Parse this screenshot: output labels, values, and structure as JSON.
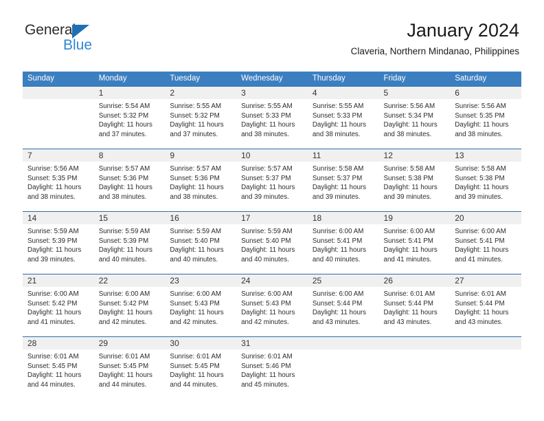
{
  "brand": {
    "name_top": "General",
    "name_bottom": "Blue",
    "accent_color": "#2f86d4",
    "triangle_color": "#1f6fb5"
  },
  "header": {
    "title": "January 2024",
    "subtitle": "Claveria, Northern Mindanao, Philippines"
  },
  "theme": {
    "header_row_bg": "#3c7fc1",
    "daynum_bg": "#f0f0f0",
    "row_border": "#2e6ca8",
    "text": "#2b2b2b"
  },
  "weekday_headers": [
    "Sunday",
    "Monday",
    "Tuesday",
    "Wednesday",
    "Thursday",
    "Friday",
    "Saturday"
  ],
  "labels": {
    "sunrise_prefix": "Sunrise:",
    "sunset_prefix": "Sunset:",
    "daylight_prefix": "Daylight:"
  },
  "weeks": [
    [
      {
        "day": "",
        "empty": true,
        "line1": "",
        "line2": "",
        "line3": "",
        "line4": ""
      },
      {
        "day": "1",
        "line1": "Sunrise: 5:54 AM",
        "line2": "Sunset: 5:32 PM",
        "line3": "Daylight: 11 hours",
        "line4": "and 37 minutes."
      },
      {
        "day": "2",
        "line1": "Sunrise: 5:55 AM",
        "line2": "Sunset: 5:32 PM",
        "line3": "Daylight: 11 hours",
        "line4": "and 37 minutes."
      },
      {
        "day": "3",
        "line1": "Sunrise: 5:55 AM",
        "line2": "Sunset: 5:33 PM",
        "line3": "Daylight: 11 hours",
        "line4": "and 38 minutes."
      },
      {
        "day": "4",
        "line1": "Sunrise: 5:55 AM",
        "line2": "Sunset: 5:33 PM",
        "line3": "Daylight: 11 hours",
        "line4": "and 38 minutes."
      },
      {
        "day": "5",
        "line1": "Sunrise: 5:56 AM",
        "line2": "Sunset: 5:34 PM",
        "line3": "Daylight: 11 hours",
        "line4": "and 38 minutes."
      },
      {
        "day": "6",
        "line1": "Sunrise: 5:56 AM",
        "line2": "Sunset: 5:35 PM",
        "line3": "Daylight: 11 hours",
        "line4": "and 38 minutes."
      }
    ],
    [
      {
        "day": "7",
        "line1": "Sunrise: 5:56 AM",
        "line2": "Sunset: 5:35 PM",
        "line3": "Daylight: 11 hours",
        "line4": "and 38 minutes."
      },
      {
        "day": "8",
        "line1": "Sunrise: 5:57 AM",
        "line2": "Sunset: 5:36 PM",
        "line3": "Daylight: 11 hours",
        "line4": "and 38 minutes."
      },
      {
        "day": "9",
        "line1": "Sunrise: 5:57 AM",
        "line2": "Sunset: 5:36 PM",
        "line3": "Daylight: 11 hours",
        "line4": "and 38 minutes."
      },
      {
        "day": "10",
        "line1": "Sunrise: 5:57 AM",
        "line2": "Sunset: 5:37 PM",
        "line3": "Daylight: 11 hours",
        "line4": "and 39 minutes."
      },
      {
        "day": "11",
        "line1": "Sunrise: 5:58 AM",
        "line2": "Sunset: 5:37 PM",
        "line3": "Daylight: 11 hours",
        "line4": "and 39 minutes."
      },
      {
        "day": "12",
        "line1": "Sunrise: 5:58 AM",
        "line2": "Sunset: 5:38 PM",
        "line3": "Daylight: 11 hours",
        "line4": "and 39 minutes."
      },
      {
        "day": "13",
        "line1": "Sunrise: 5:58 AM",
        "line2": "Sunset: 5:38 PM",
        "line3": "Daylight: 11 hours",
        "line4": "and 39 minutes."
      }
    ],
    [
      {
        "day": "14",
        "line1": "Sunrise: 5:59 AM",
        "line2": "Sunset: 5:39 PM",
        "line3": "Daylight: 11 hours",
        "line4": "and 39 minutes."
      },
      {
        "day": "15",
        "line1": "Sunrise: 5:59 AM",
        "line2": "Sunset: 5:39 PM",
        "line3": "Daylight: 11 hours",
        "line4": "and 40 minutes."
      },
      {
        "day": "16",
        "line1": "Sunrise: 5:59 AM",
        "line2": "Sunset: 5:40 PM",
        "line3": "Daylight: 11 hours",
        "line4": "and 40 minutes."
      },
      {
        "day": "17",
        "line1": "Sunrise: 5:59 AM",
        "line2": "Sunset: 5:40 PM",
        "line3": "Daylight: 11 hours",
        "line4": "and 40 minutes."
      },
      {
        "day": "18",
        "line1": "Sunrise: 6:00 AM",
        "line2": "Sunset: 5:41 PM",
        "line3": "Daylight: 11 hours",
        "line4": "and 40 minutes."
      },
      {
        "day": "19",
        "line1": "Sunrise: 6:00 AM",
        "line2": "Sunset: 5:41 PM",
        "line3": "Daylight: 11 hours",
        "line4": "and 41 minutes."
      },
      {
        "day": "20",
        "line1": "Sunrise: 6:00 AM",
        "line2": "Sunset: 5:41 PM",
        "line3": "Daylight: 11 hours",
        "line4": "and 41 minutes."
      }
    ],
    [
      {
        "day": "21",
        "line1": "Sunrise: 6:00 AM",
        "line2": "Sunset: 5:42 PM",
        "line3": "Daylight: 11 hours",
        "line4": "and 41 minutes."
      },
      {
        "day": "22",
        "line1": "Sunrise: 6:00 AM",
        "line2": "Sunset: 5:42 PM",
        "line3": "Daylight: 11 hours",
        "line4": "and 42 minutes."
      },
      {
        "day": "23",
        "line1": "Sunrise: 6:00 AM",
        "line2": "Sunset: 5:43 PM",
        "line3": "Daylight: 11 hours",
        "line4": "and 42 minutes."
      },
      {
        "day": "24",
        "line1": "Sunrise: 6:00 AM",
        "line2": "Sunset: 5:43 PM",
        "line3": "Daylight: 11 hours",
        "line4": "and 42 minutes."
      },
      {
        "day": "25",
        "line1": "Sunrise: 6:00 AM",
        "line2": "Sunset: 5:44 PM",
        "line3": "Daylight: 11 hours",
        "line4": "and 43 minutes."
      },
      {
        "day": "26",
        "line1": "Sunrise: 6:01 AM",
        "line2": "Sunset: 5:44 PM",
        "line3": "Daylight: 11 hours",
        "line4": "and 43 minutes."
      },
      {
        "day": "27",
        "line1": "Sunrise: 6:01 AM",
        "line2": "Sunset: 5:44 PM",
        "line3": "Daylight: 11 hours",
        "line4": "and 43 minutes."
      }
    ],
    [
      {
        "day": "28",
        "line1": "Sunrise: 6:01 AM",
        "line2": "Sunset: 5:45 PM",
        "line3": "Daylight: 11 hours",
        "line4": "and 44 minutes."
      },
      {
        "day": "29",
        "line1": "Sunrise: 6:01 AM",
        "line2": "Sunset: 5:45 PM",
        "line3": "Daylight: 11 hours",
        "line4": "and 44 minutes."
      },
      {
        "day": "30",
        "line1": "Sunrise: 6:01 AM",
        "line2": "Sunset: 5:45 PM",
        "line3": "Daylight: 11 hours",
        "line4": "and 44 minutes."
      },
      {
        "day": "31",
        "line1": "Sunrise: 6:01 AM",
        "line2": "Sunset: 5:46 PM",
        "line3": "Daylight: 11 hours",
        "line4": "and 45 minutes."
      },
      {
        "day": "",
        "empty": true,
        "line1": "",
        "line2": "",
        "line3": "",
        "line4": ""
      },
      {
        "day": "",
        "empty": true,
        "line1": "",
        "line2": "",
        "line3": "",
        "line4": ""
      },
      {
        "day": "",
        "empty": true,
        "line1": "",
        "line2": "",
        "line3": "",
        "line4": ""
      }
    ]
  ]
}
